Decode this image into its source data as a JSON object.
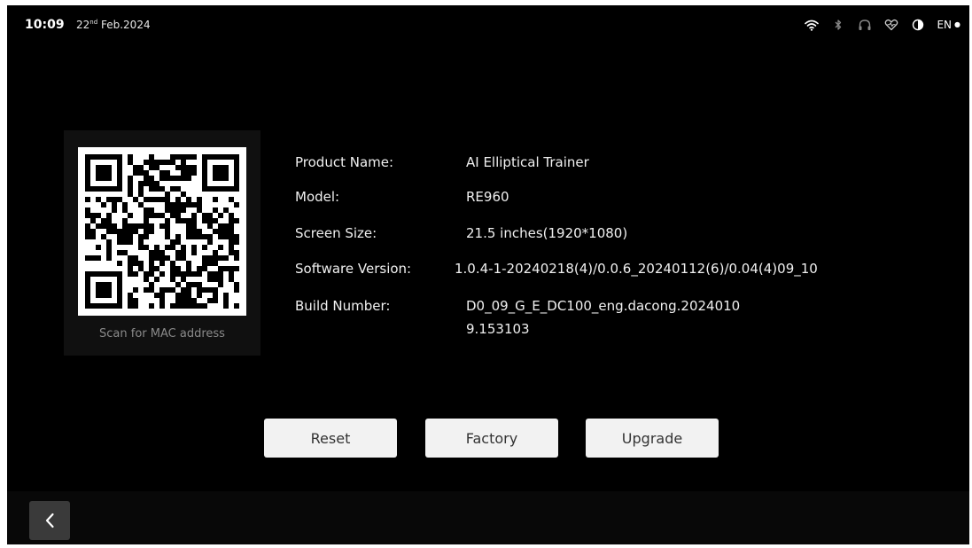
{
  "status_bar": {
    "time": "10:09",
    "date_day": "22",
    "date_suffix": "nd",
    "date_rest": " Feb.2024",
    "language": "EN",
    "icons": [
      "wifi-icon",
      "bluetooth-icon",
      "headphones-icon",
      "heart-rate-icon",
      "brightness-icon",
      "chevron-down-icon"
    ]
  },
  "qr": {
    "caption": "Scan for MAC address"
  },
  "info": {
    "product_name_label": "Product Name:",
    "product_name_value": "AI Elliptical Trainer",
    "model_label": "Model:",
    "model_value": "RE960",
    "screen_size_label": "Screen Size:",
    "screen_size_value": "21.5 inches(1920*1080)",
    "software_version_label": "Software Version:",
    "software_version_value": "1.0.4-1-20240218(4)/0.0.6_20240112(6)/0.04(4)09_10",
    "build_number_label": "Build Number:",
    "build_number_value_line1": "D0_09_G_E_DC100_eng.dacong.2024010",
    "build_number_value_line2": "9.153103"
  },
  "buttons": {
    "reset": "Reset",
    "factory": "Factory",
    "upgrade": "Upgrade"
  },
  "nav": {
    "back_icon": "chevron-left-icon"
  },
  "colors": {
    "background": "#000000",
    "button_bg": "#f2f2f2",
    "button_text": "#333333",
    "caption_text": "#8a8a8a"
  }
}
